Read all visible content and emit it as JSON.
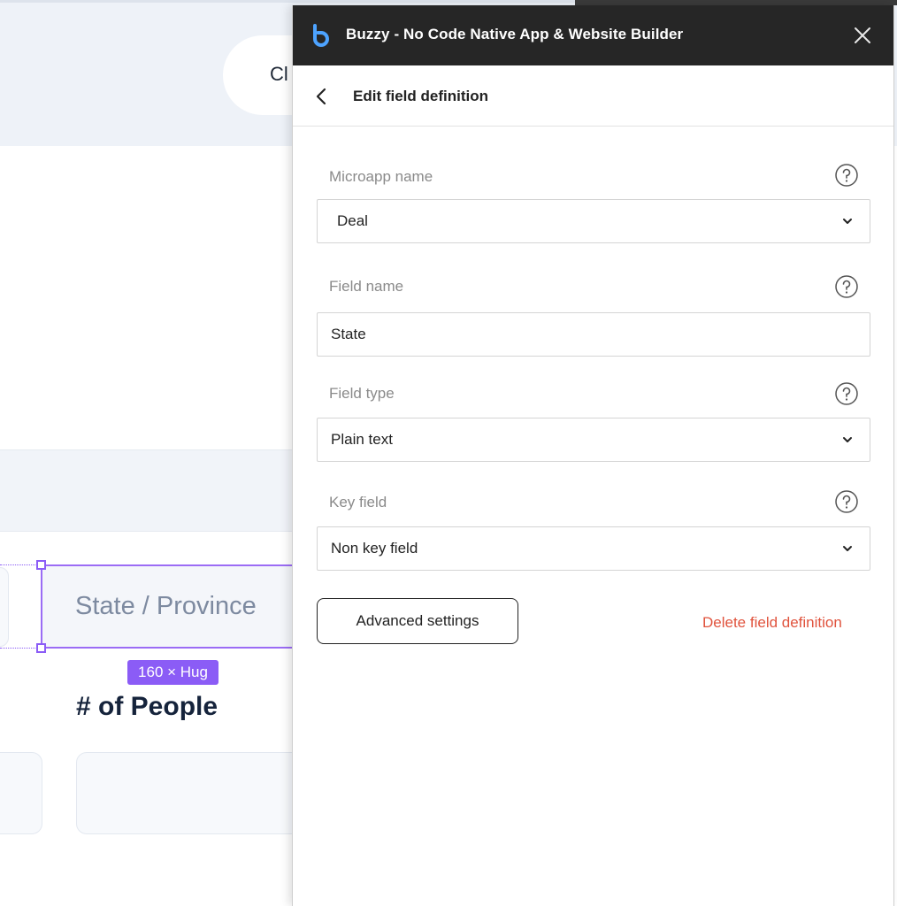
{
  "background": {
    "pill_button_label": "Cl",
    "state_field_placeholder": "State / Province",
    "size_badge": "160 × Hug",
    "section_label": "# of People",
    "accent_color": "#8b5cf6"
  },
  "panel": {
    "title": "Buzzy - No Code Native App & Website Builder",
    "logo_icon": "buzzy-logo-icon",
    "close_icon": "close-icon",
    "subheader": {
      "back_icon": "chevron-left-icon",
      "title": "Edit field definition"
    },
    "fields": {
      "microapp": {
        "label": "Microapp name",
        "value": "Deal"
      },
      "field_name": {
        "label": "Field name",
        "value": "State"
      },
      "field_type": {
        "label": "Field type",
        "value": "Plain text"
      },
      "key_field": {
        "label": "Key field",
        "value": "Non key field"
      }
    },
    "actions": {
      "advanced_label": "Advanced settings",
      "delete_label": "Delete field definition",
      "delete_color": "#e0533d"
    }
  }
}
